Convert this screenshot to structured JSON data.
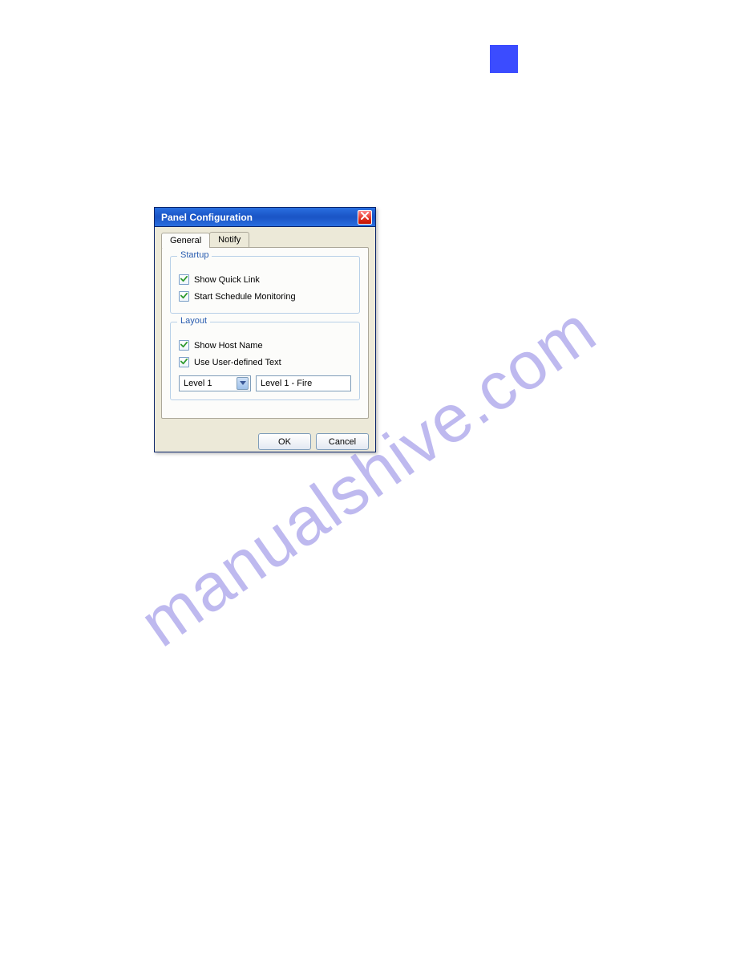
{
  "page": {
    "watermark": "manualshive.com"
  },
  "dialog": {
    "title": "Panel Configuration",
    "tabs": {
      "general": "General",
      "notify": "Notify"
    },
    "groups": {
      "startup": {
        "legend": "Startup",
        "show_quick_link": "Show Quick Link",
        "start_schedule_monitoring": "Start Schedule Monitoring"
      },
      "layout": {
        "legend": "Layout",
        "show_host_name": "Show Host Name",
        "use_user_defined_text": "Use User-defined Text",
        "level_select": "Level 1",
        "level_text": "Level 1 - Fire"
      }
    },
    "buttons": {
      "ok": "OK",
      "cancel": "Cancel"
    }
  }
}
